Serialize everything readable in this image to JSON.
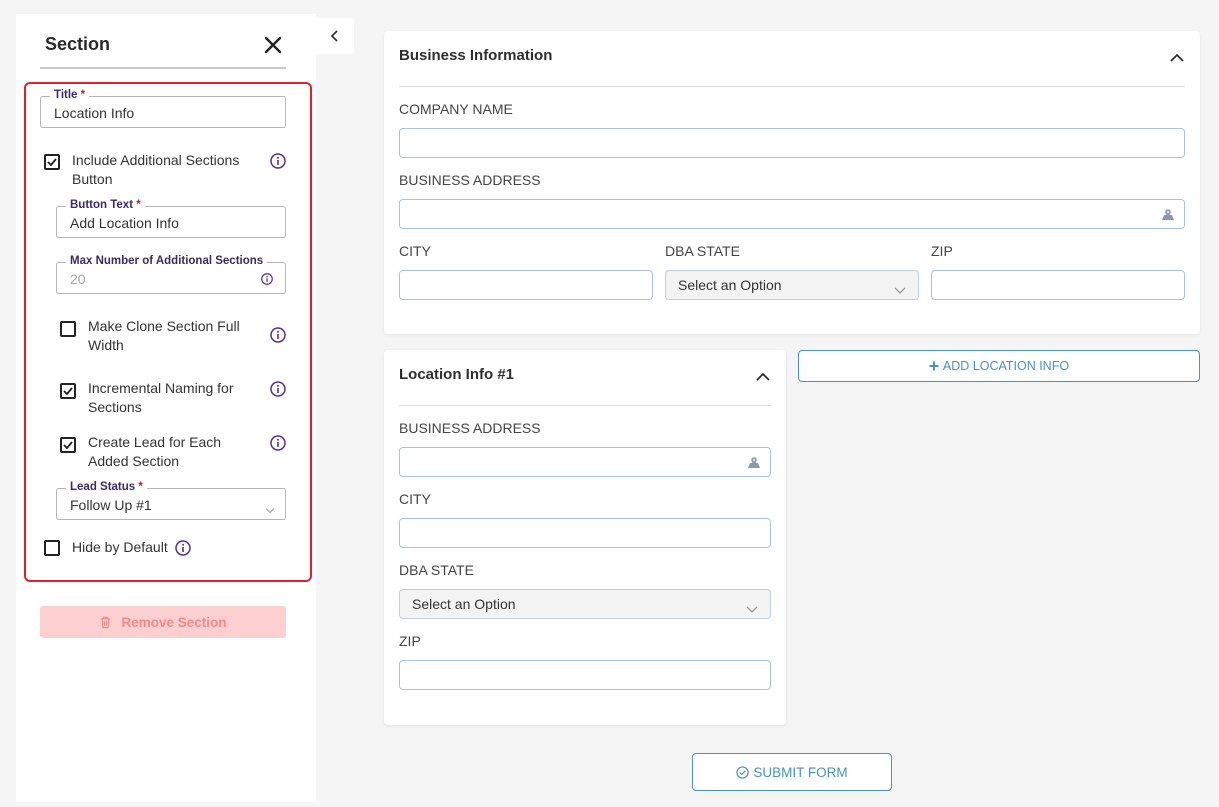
{
  "panel": {
    "title": "Section",
    "title_field": {
      "label": "Title",
      "required_mark": "*",
      "value": "Location Info"
    },
    "include_additional": {
      "label": "Include Additional Sections Button",
      "checked": true
    },
    "button_text": {
      "label": "Button Text",
      "required_mark": "*",
      "value": "Add Location Info"
    },
    "max_sections": {
      "label": "Max Number of Additional Sections",
      "placeholder": "20"
    },
    "clone_full_width": {
      "label": "Make Clone Section Full Width",
      "checked": false
    },
    "incremental_naming": {
      "label": "Incremental Naming for Sections",
      "checked": true
    },
    "create_lead": {
      "label": "Create Lead for Each Added Section",
      "checked": true
    },
    "lead_status": {
      "label": "Lead Status",
      "required_mark": "*",
      "value": "Follow Up #1"
    },
    "hide_default": {
      "label": "Hide by Default",
      "checked": false
    },
    "remove_label": "Remove Section"
  },
  "business_card": {
    "title": "Business Information",
    "company_name": "COMPANY NAME",
    "business_address": "BUSINESS ADDRESS",
    "city": "CITY",
    "dba_state": "DBA STATE",
    "zip": "ZIP",
    "select_placeholder": "Select an Option"
  },
  "location_card": {
    "title": "Location Info #1",
    "business_address": "BUSINESS ADDRESS",
    "city": "CITY",
    "dba_state": "DBA STATE",
    "zip": "ZIP",
    "select_placeholder": "Select an Option"
  },
  "add_location_label": "ADD LOCATION INFO",
  "submit_label": "SUBMIT FORM",
  "colors": {
    "accent": "#4a8fc7",
    "highlight_border": "#e0202c",
    "legend_text": "#3a2a68",
    "info_icon": "#5b2d8e",
    "danger_light": "#fcd0d0"
  }
}
